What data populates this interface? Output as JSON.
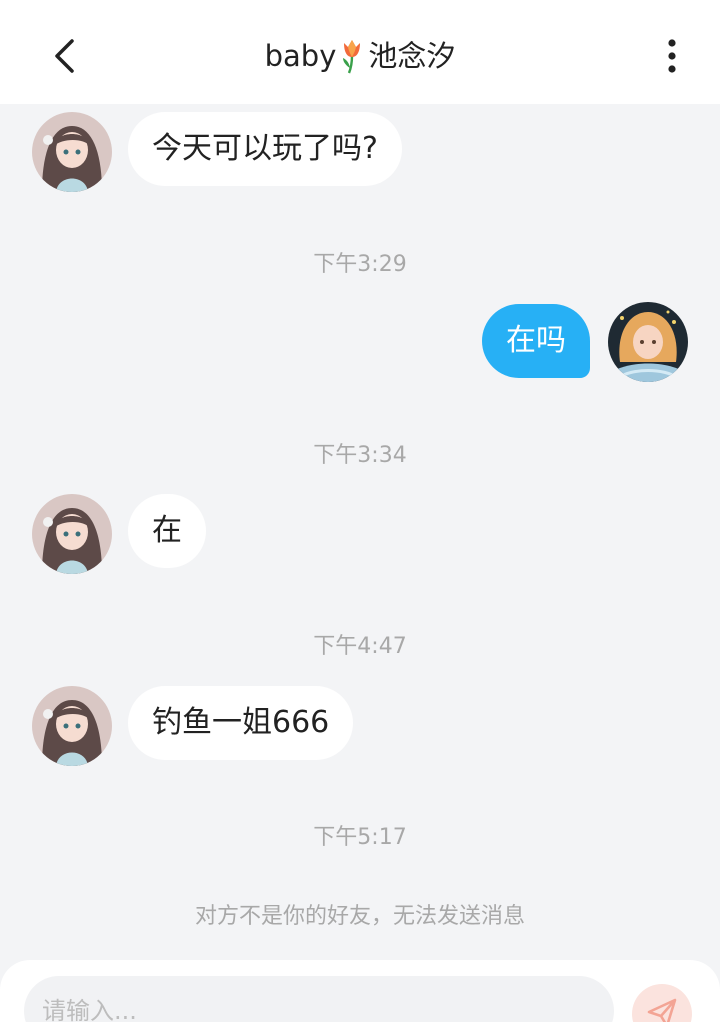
{
  "header": {
    "title_prefix": "baby",
    "title_suffix": "池念汐",
    "title_icon": "tulip-icon",
    "back_icon": "chevron-left-icon",
    "more_icon": "more-vertical-icon"
  },
  "messages": [
    {
      "sender": "other",
      "text": "今天可以玩了吗?"
    },
    {
      "time": "下午3:29"
    },
    {
      "sender": "self",
      "text": "在吗"
    },
    {
      "time": "下午3:34"
    },
    {
      "sender": "other",
      "text": "在"
    },
    {
      "time": "下午4:47"
    },
    {
      "sender": "other",
      "text": "钓鱼一姐666"
    },
    {
      "time": "下午5:17"
    }
  ],
  "notice": "对方不是你的好友，无法发送消息",
  "input": {
    "placeholder": "请输入...",
    "value": ""
  },
  "colors": {
    "self_bubble": "#27b0f5",
    "background": "#f3f4f6",
    "time_text": "#a8a8a8",
    "send_button": "#fbe3de"
  }
}
